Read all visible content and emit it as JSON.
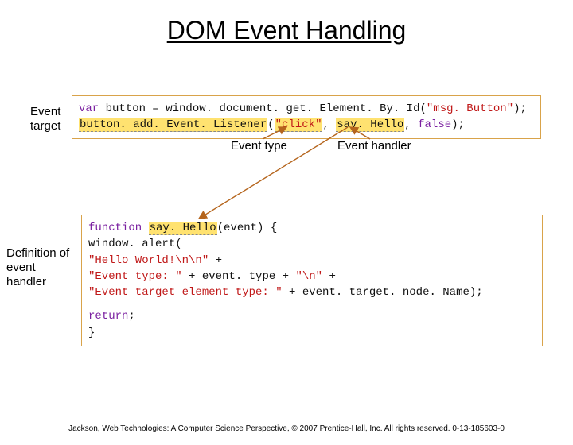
{
  "title": "DOM Event Handling",
  "labels": {
    "event_target": "Event target",
    "event_type": "Event type",
    "event_handler": "Event handler",
    "def_handler": "Definition of event handler"
  },
  "code1": {
    "l1_kw": "var",
    "l1_a": " button = window. document. get. Element. By. Id(",
    "l1_str": "\"msg. Button\"",
    "l1_b": ");",
    "l2_hl1": "button. add. Event. Listener",
    "l2_a": "(",
    "l2_hl2": "\"click\"",
    "l2_b": ", ",
    "l2_hl3": "say. Hello",
    "l2_c": ", ",
    "l2_kw": "false",
    "l2_d": ");"
  },
  "code2": {
    "l1_kw": "function",
    "l1_a": " ",
    "l1_hl": "say. Hello",
    "l1_b": "(event) {",
    "l2": "    window. alert(",
    "l3_a": "        ",
    "l3_str": "\"Hello World!\\n\\n\"",
    "l3_b": " +",
    "l4_a": "        ",
    "l4_str1": "\"Event type: \"",
    "l4_b": " + event. type + ",
    "l4_str2": "\"\\n\"",
    "l4_c": " +",
    "l5_a": "        ",
    "l5_str": "\"Event target element type: \"",
    "l5_b": " + event. target. node. Name);",
    "l6_a": "    ",
    "l6_kw": "return",
    "l6_b": ";",
    "l7": "}"
  },
  "footer": "Jackson, Web Technologies: A Computer Science Perspective, © 2007 Prentice-Hall, Inc. All rights reserved. 0-13-185603-0"
}
